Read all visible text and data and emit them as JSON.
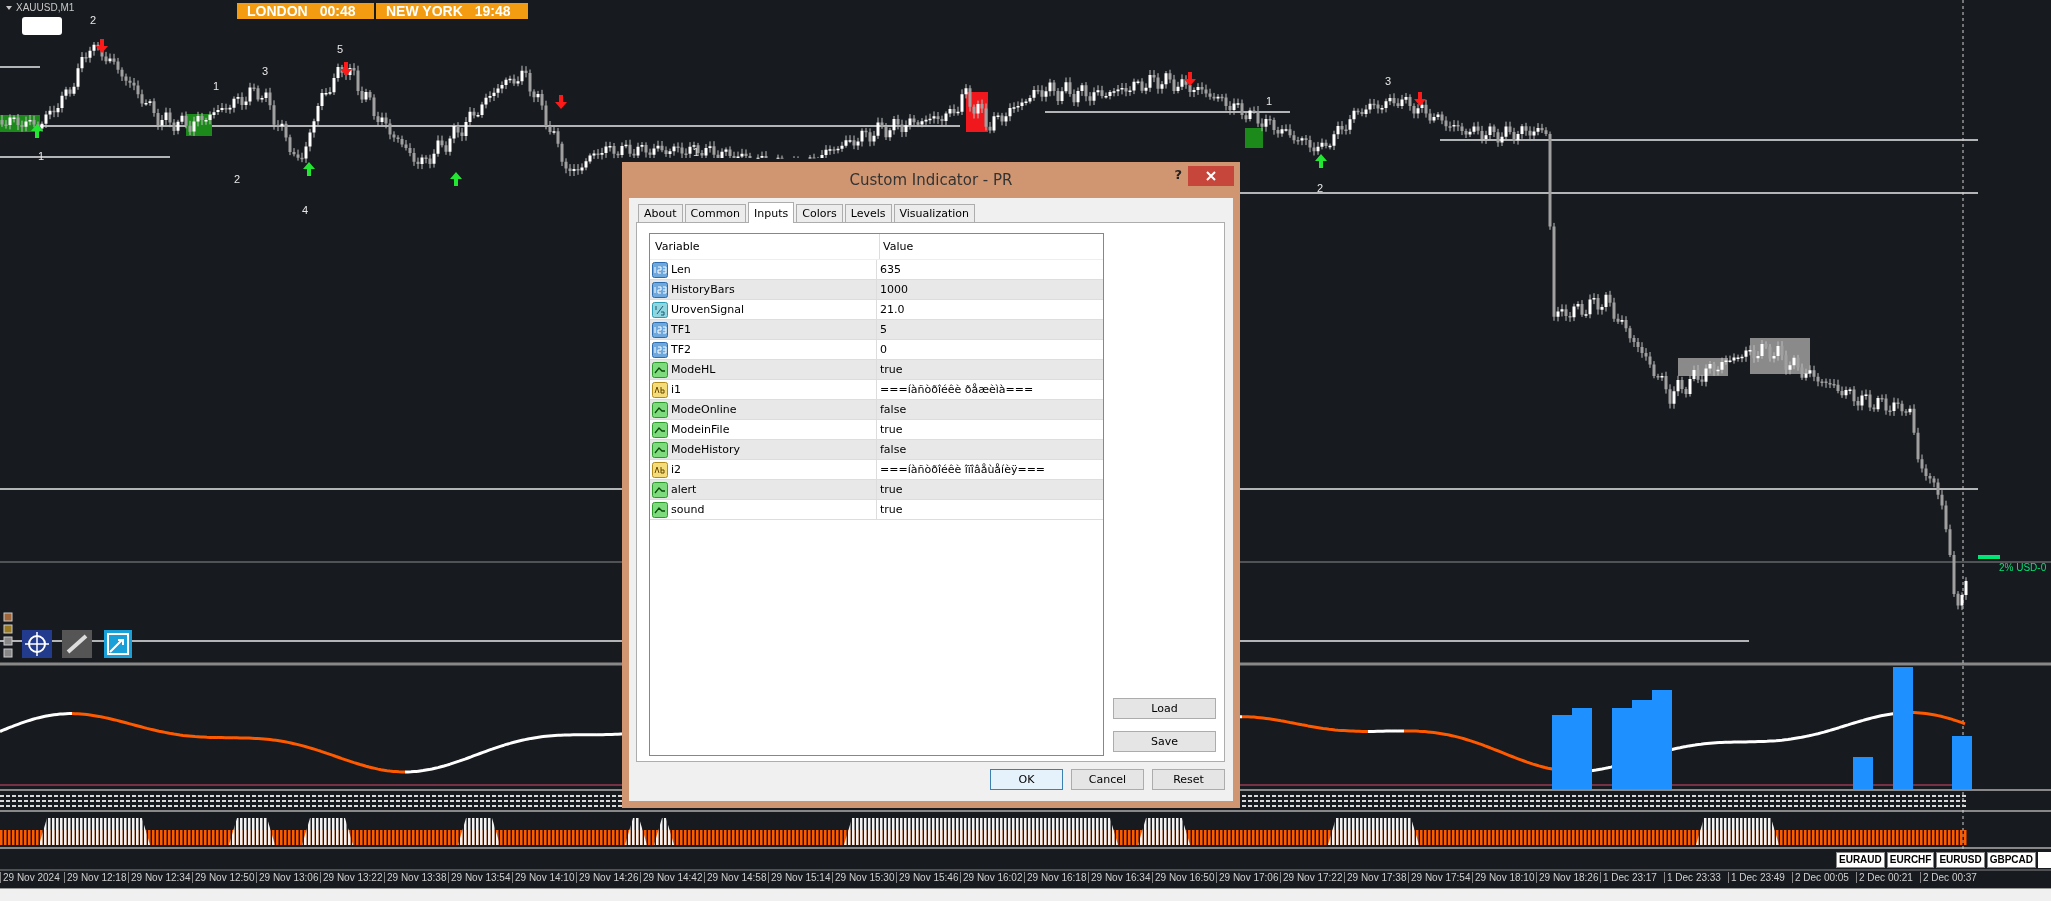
{
  "chart": {
    "symbol": "XAUUSD,M1",
    "sessions": [
      {
        "city": "LONDON",
        "time": "00:48"
      },
      {
        "city": "NEW YORK",
        "time": "19:48"
      }
    ],
    "wave_labels": [
      "2",
      "1",
      "1",
      "2",
      "3",
      "5",
      "4",
      "1",
      "1",
      "2",
      "3"
    ],
    "line_label": "2% USD-0",
    "time_axis": [
      "29 Nov 2024",
      "29 Nov 12:18",
      "29 Nov 12:34",
      "29 Nov 12:50",
      "29 Nov 13:06",
      "29 Nov 13:22",
      "29 Nov 13:38",
      "29 Nov 13:54",
      "29 Nov 14:10",
      "29 Nov 14:26",
      "29 Nov 14:42",
      "29 Nov 14:58",
      "29 Nov 15:14",
      "29 Nov 15:30",
      "29 Nov 15:46",
      "29 Nov 16:02",
      "29 Nov 16:18",
      "29 Nov 16:34",
      "29 Nov 16:50",
      "29 Nov 17:06",
      "29 Nov 17:22",
      "29 Nov 17:38",
      "29 Nov 17:54",
      "29 Nov 18:10",
      "29 Nov 18:26",
      "1 Dec 23:17",
      "1 Dec 23:33",
      "1 Dec 23:49",
      "2 Dec 00:05",
      "2 Dec 00:21",
      "2 Dec 00:37"
    ],
    "symbol_tabs": [
      "EURAUD",
      "EURCHF",
      "EURUSD",
      "GBPCAD"
    ]
  },
  "dialog": {
    "title": "Custom Indicator - PR",
    "help": "?",
    "tabs": [
      {
        "label": "About",
        "selected": false
      },
      {
        "label": "Common",
        "selected": false
      },
      {
        "label": "Inputs",
        "selected": true
      },
      {
        "label": "Colors",
        "selected": false
      },
      {
        "label": "Levels",
        "selected": false
      },
      {
        "label": "Visualization",
        "selected": false
      }
    ],
    "columns": [
      "Variable",
      "Value"
    ],
    "rows": [
      {
        "kind": "int",
        "name": "Len",
        "value": "635"
      },
      {
        "kind": "int",
        "name": "HistoryBars",
        "value": "1000"
      },
      {
        "kind": "double",
        "name": "UrovenSignal",
        "value": "21.0"
      },
      {
        "kind": "int",
        "name": "TF1",
        "value": "5"
      },
      {
        "kind": "int",
        "name": "TF2",
        "value": "0"
      },
      {
        "kind": "bool",
        "name": "ModeHL",
        "value": "true"
      },
      {
        "kind": "string",
        "name": "i1",
        "value": "===íàñòðîéêè ðåæèìà==="
      },
      {
        "kind": "bool",
        "name": "ModeOnline",
        "value": "false"
      },
      {
        "kind": "bool",
        "name": "ModeinFile",
        "value": "true"
      },
      {
        "kind": "bool",
        "name": "ModeHistory",
        "value": "false"
      },
      {
        "kind": "string",
        "name": "i2",
        "value": "===íàñòðîéêè îïîâåùåíèÿ==="
      },
      {
        "kind": "bool",
        "name": "alert",
        "value": "true"
      },
      {
        "kind": "bool",
        "name": "sound",
        "value": "true"
      }
    ],
    "side_buttons": [
      "Load",
      "Save"
    ],
    "buttons": [
      {
        "label": "OK",
        "focused": true
      },
      {
        "label": "Cancel",
        "focused": false
      },
      {
        "label": "Reset",
        "focused": false
      }
    ]
  }
}
